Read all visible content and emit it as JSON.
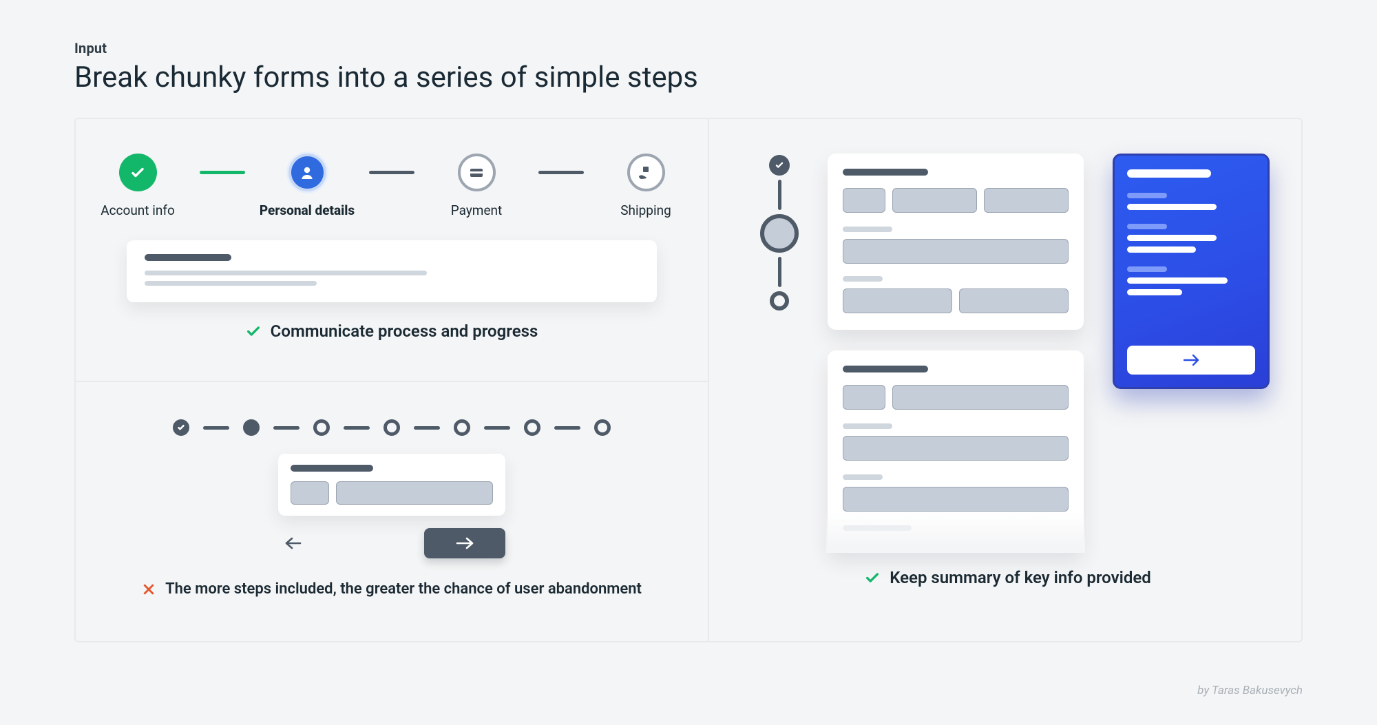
{
  "eyebrow": "Input",
  "title": "Break chunky forms into a series of simple steps",
  "panelA": {
    "steps": [
      {
        "label": "Account info",
        "state": "done",
        "icon": "check"
      },
      {
        "label": "Personal details",
        "state": "active",
        "icon": "person"
      },
      {
        "label": "Payment",
        "state": "pending",
        "icon": "card"
      },
      {
        "label": "Shipping",
        "state": "pending",
        "icon": "hand-box"
      }
    ],
    "caption": "Communicate process and progress"
  },
  "panelB": {
    "step_count": 7,
    "caption": "The more steps included, the greater the chance of user abandonment"
  },
  "panelC": {
    "caption": "Keep summary of key info provided"
  },
  "byline": "by Taras Bakusevych"
}
